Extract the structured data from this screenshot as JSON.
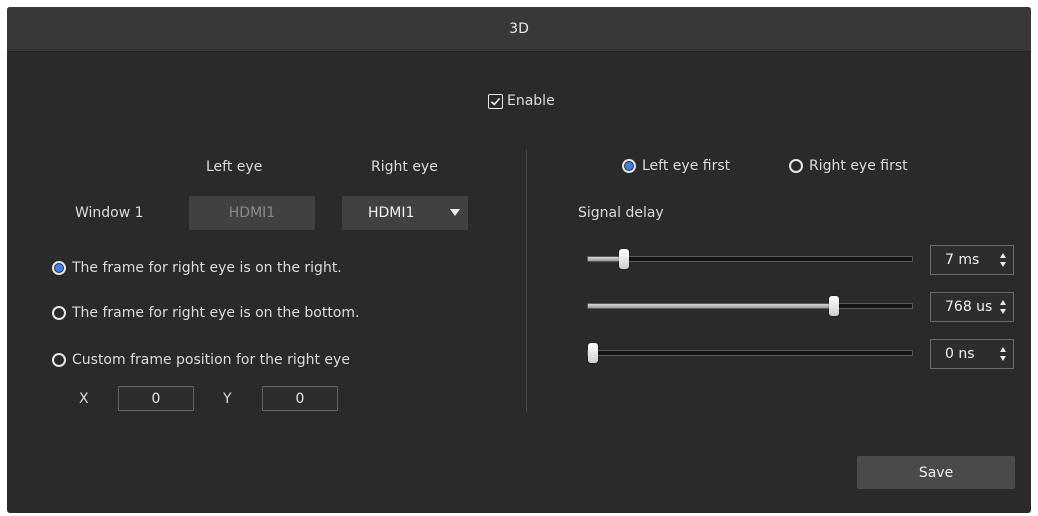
{
  "dialog": {
    "title": "3D"
  },
  "enable": {
    "label": "Enable",
    "checked": true
  },
  "columns": {
    "left_eye": "Left eye",
    "right_eye": "Right eye"
  },
  "window_row": {
    "label": "Window 1",
    "left_source": "HDMI1",
    "right_source": "HDMI1"
  },
  "frame_options": [
    {
      "label": "The frame for right eye is on the right.",
      "selected": true
    },
    {
      "label": "The frame for right eye is on the bottom.",
      "selected": false
    },
    {
      "label": "Custom frame position for the right eye",
      "selected": false
    }
  ],
  "custom_position": {
    "x_label": "X",
    "x_value": "0",
    "y_label": "Y",
    "y_value": "0"
  },
  "eye_order": [
    {
      "label": "Left eye first",
      "selected": true
    },
    {
      "label": "Right eye first",
      "selected": false
    }
  ],
  "signal_delay": {
    "label": "Signal delay",
    "sliders": [
      {
        "value": "7 ms",
        "fraction": 0.11
      },
      {
        "value": "768 us",
        "fraction": 0.76
      },
      {
        "value": "0 ns",
        "fraction": 0.0
      }
    ]
  },
  "save_label": "Save",
  "colors": {
    "accent": "#3f7fe6",
    "background": "#2a2a2a",
    "titlebar": "#383838"
  }
}
